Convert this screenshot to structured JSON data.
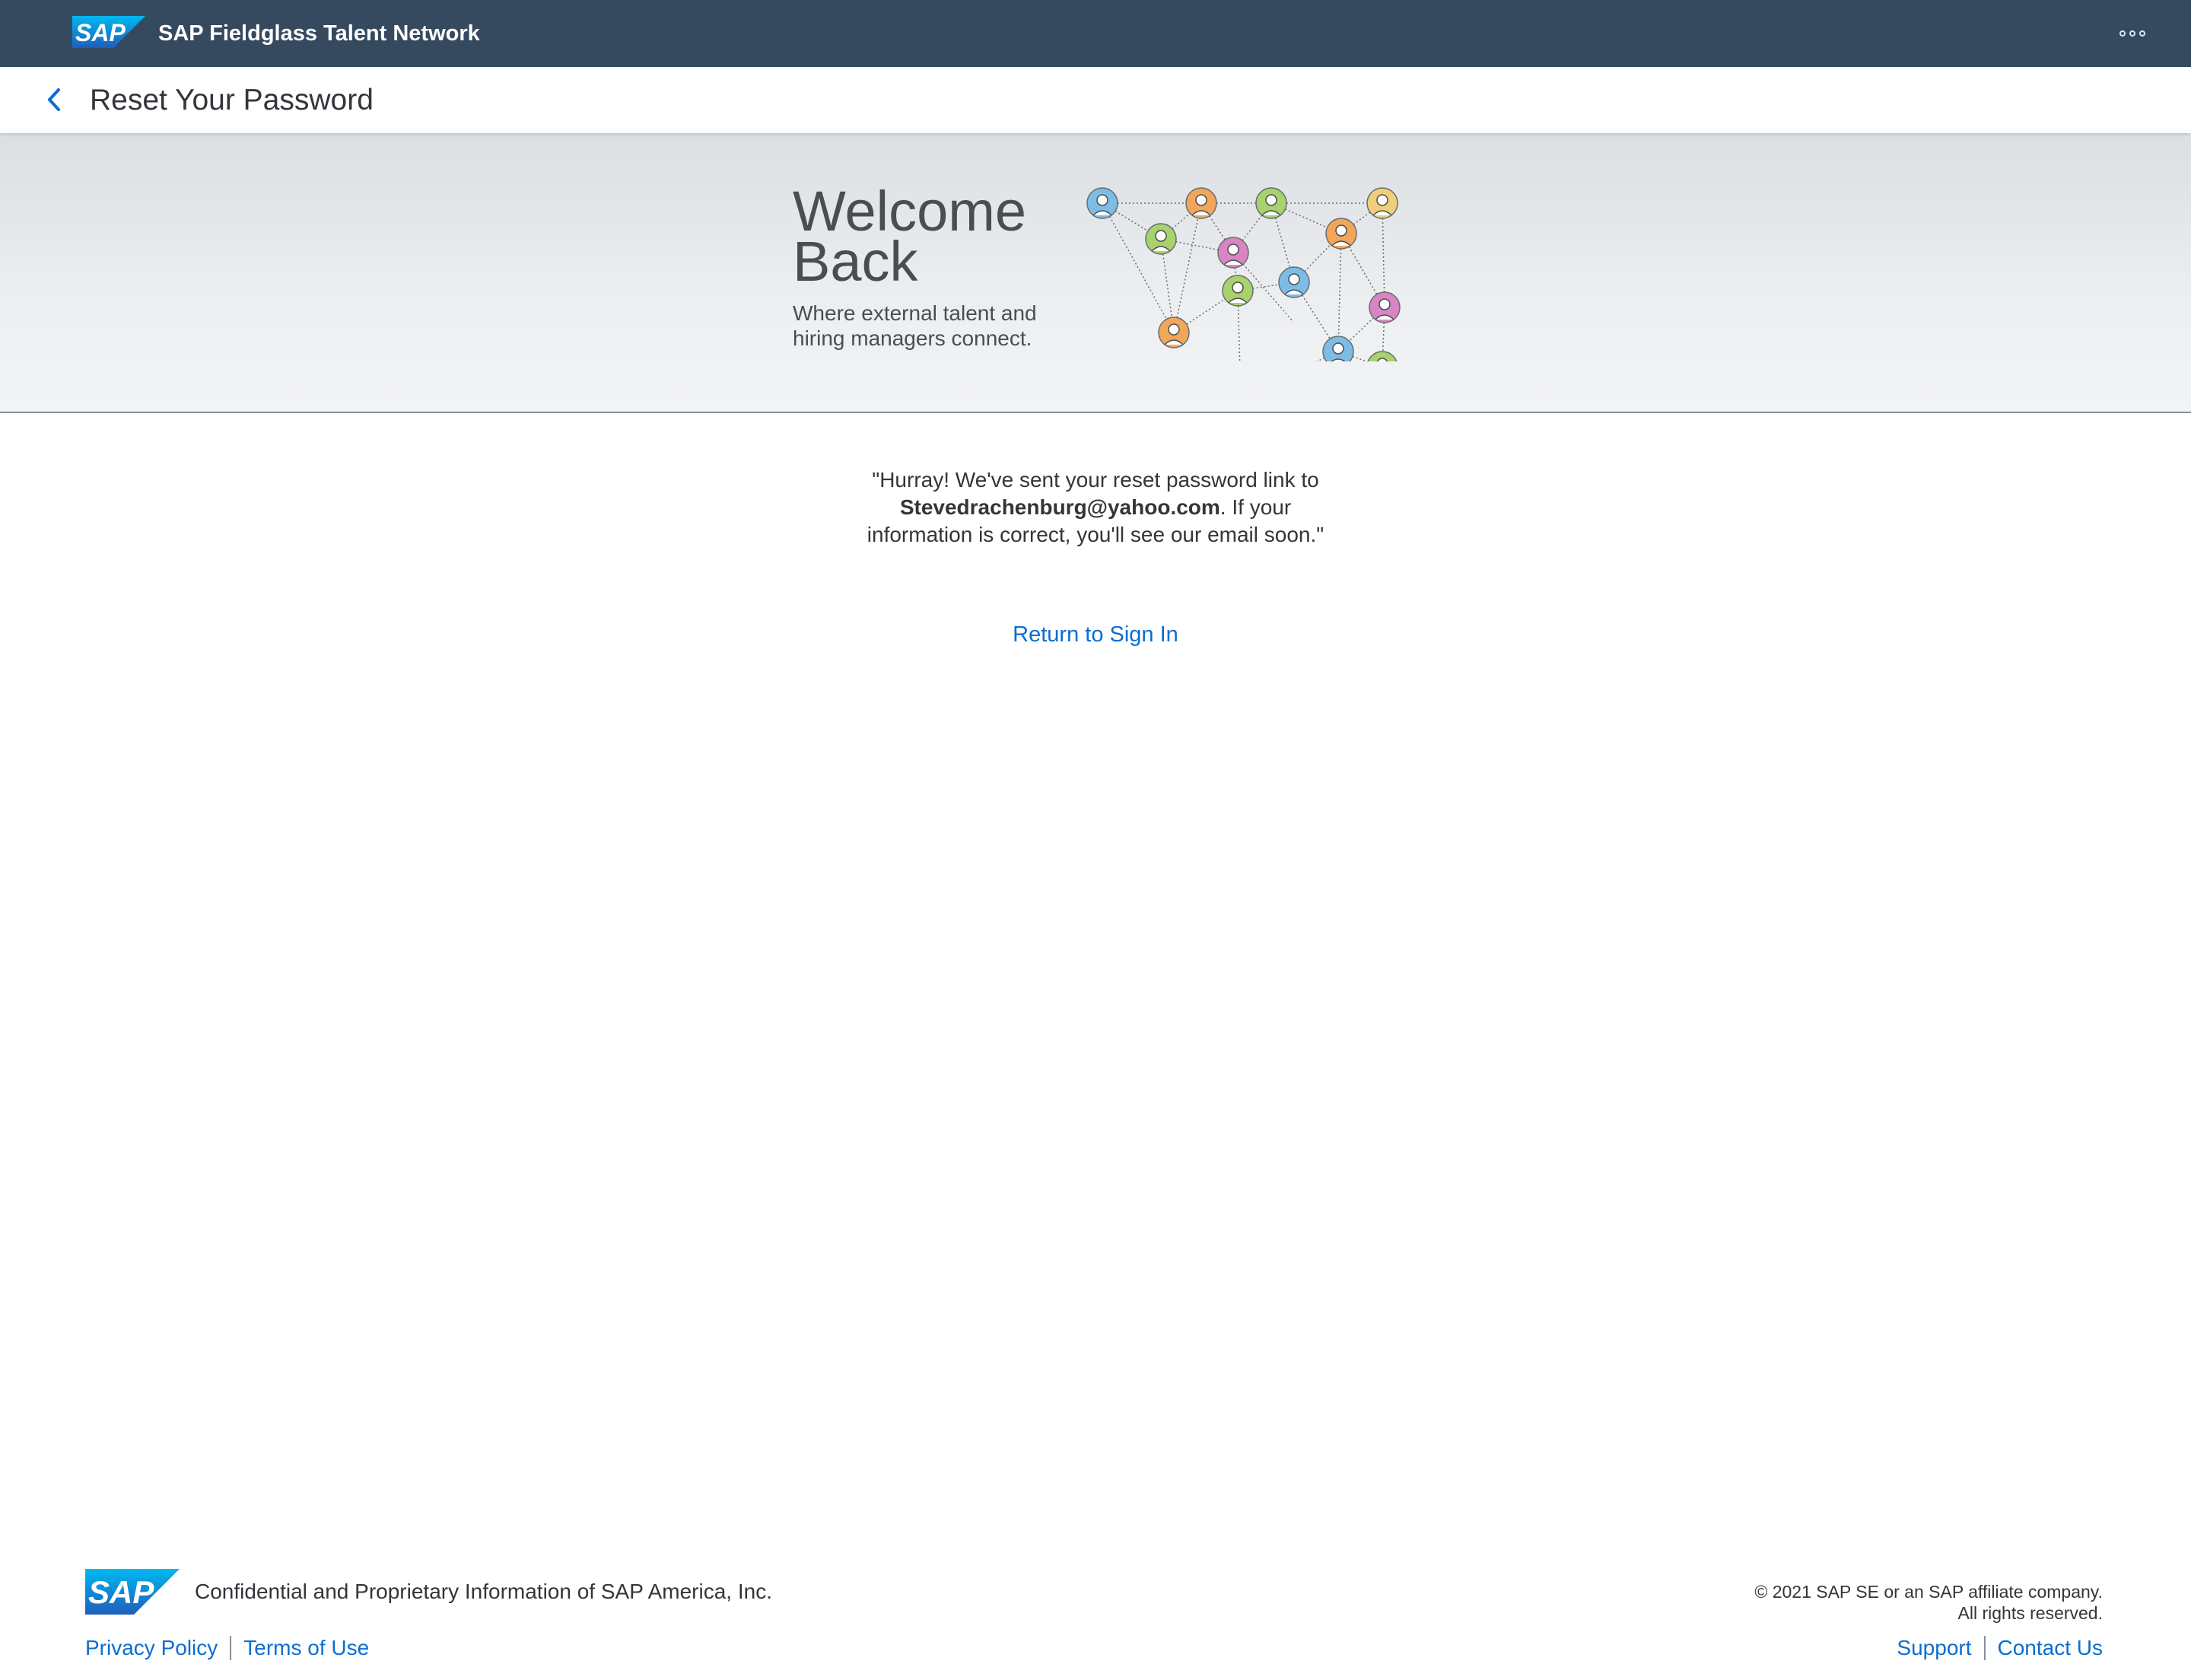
{
  "shell": {
    "logo_text": "SAP",
    "app_title": "SAP Fieldglass Talent Network",
    "overflow_icon": "overflow-menu-icon"
  },
  "header": {
    "back_icon": "chevron-left-icon",
    "title": "Reset Your Password"
  },
  "hero": {
    "title_line1": "Welcome",
    "title_line2": "Back",
    "subtitle_line1": "Where external talent and",
    "subtitle_line2": "hiring managers connect.",
    "illustration": "talent-network-illustration"
  },
  "message": {
    "part1": "\"Hurray! We've sent your reset password link to",
    "email": "Stevedrachenburg@yahoo.com",
    "part2": ". If your",
    "part3": "information is correct, you'll see our email soon.\""
  },
  "links": {
    "return_sign_in": "Return to Sign In"
  },
  "footer": {
    "logo_text": "SAP",
    "confidential": "Confidential and Proprietary Information of SAP America, Inc.",
    "privacy": "Privacy Policy",
    "terms": "Terms of Use",
    "copyright_line1": "© 2021 SAP SE or an SAP affiliate company.",
    "copyright_line2": "All rights reserved.",
    "support": "Support",
    "contact": "Contact Us"
  },
  "colors": {
    "shell_bg": "#354a5f",
    "link": "#0a6ed1",
    "text": "#32363a"
  }
}
